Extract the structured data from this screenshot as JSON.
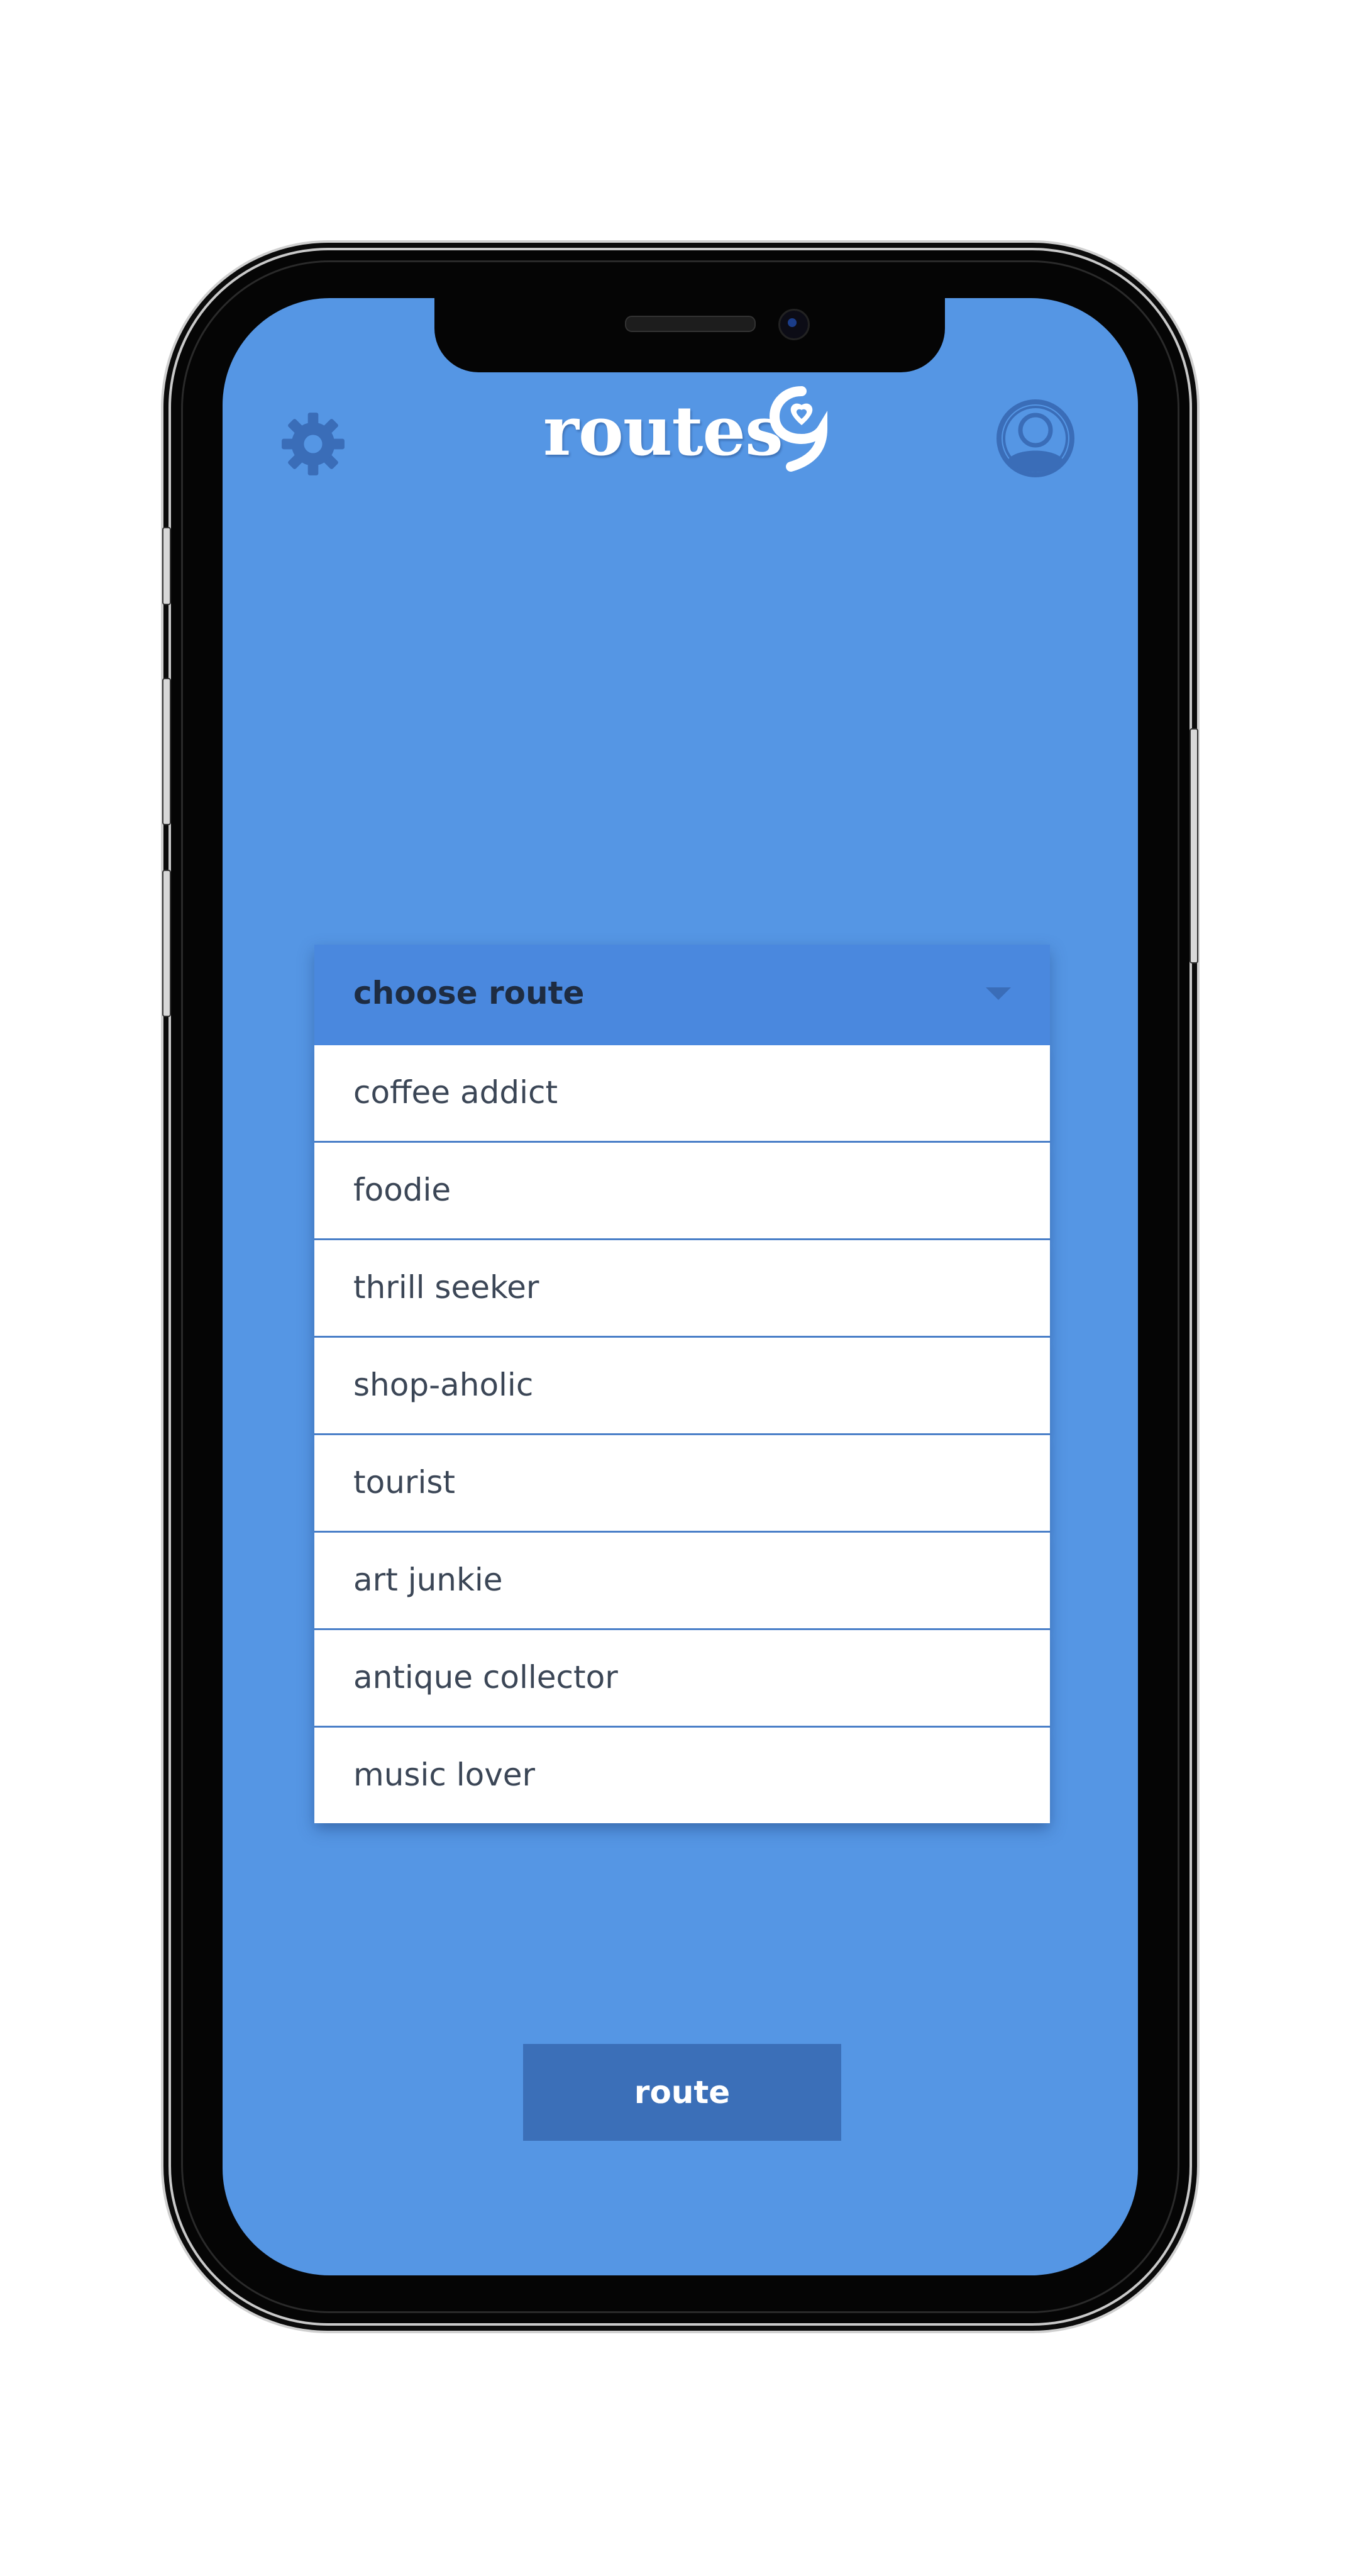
{
  "app": {
    "logo_text": "routes",
    "logo_mark_icon": "map-pin-9-icon"
  },
  "header": {
    "settings_icon": "gear-icon",
    "profile_icon": "user-circle-icon"
  },
  "dropdown": {
    "label": "choose route",
    "caret_icon": "chevron-down-icon",
    "items": [
      {
        "label": "coffee addict"
      },
      {
        "label": "foodie"
      },
      {
        "label": "thrill seeker"
      },
      {
        "label": "shop-aholic"
      },
      {
        "label": "tourist"
      },
      {
        "label": "art junkie"
      },
      {
        "label": "antique collector"
      },
      {
        "label": "music lover"
      }
    ]
  },
  "action": {
    "route_label": "route"
  },
  "colors": {
    "screen_background": "#5596e4",
    "dropdown_header": "#4a88de",
    "item_background": "#ffffff",
    "item_divider": "#4a7fc8",
    "button_background": "#3b6fb8",
    "icon_color": "#3a6db8"
  }
}
